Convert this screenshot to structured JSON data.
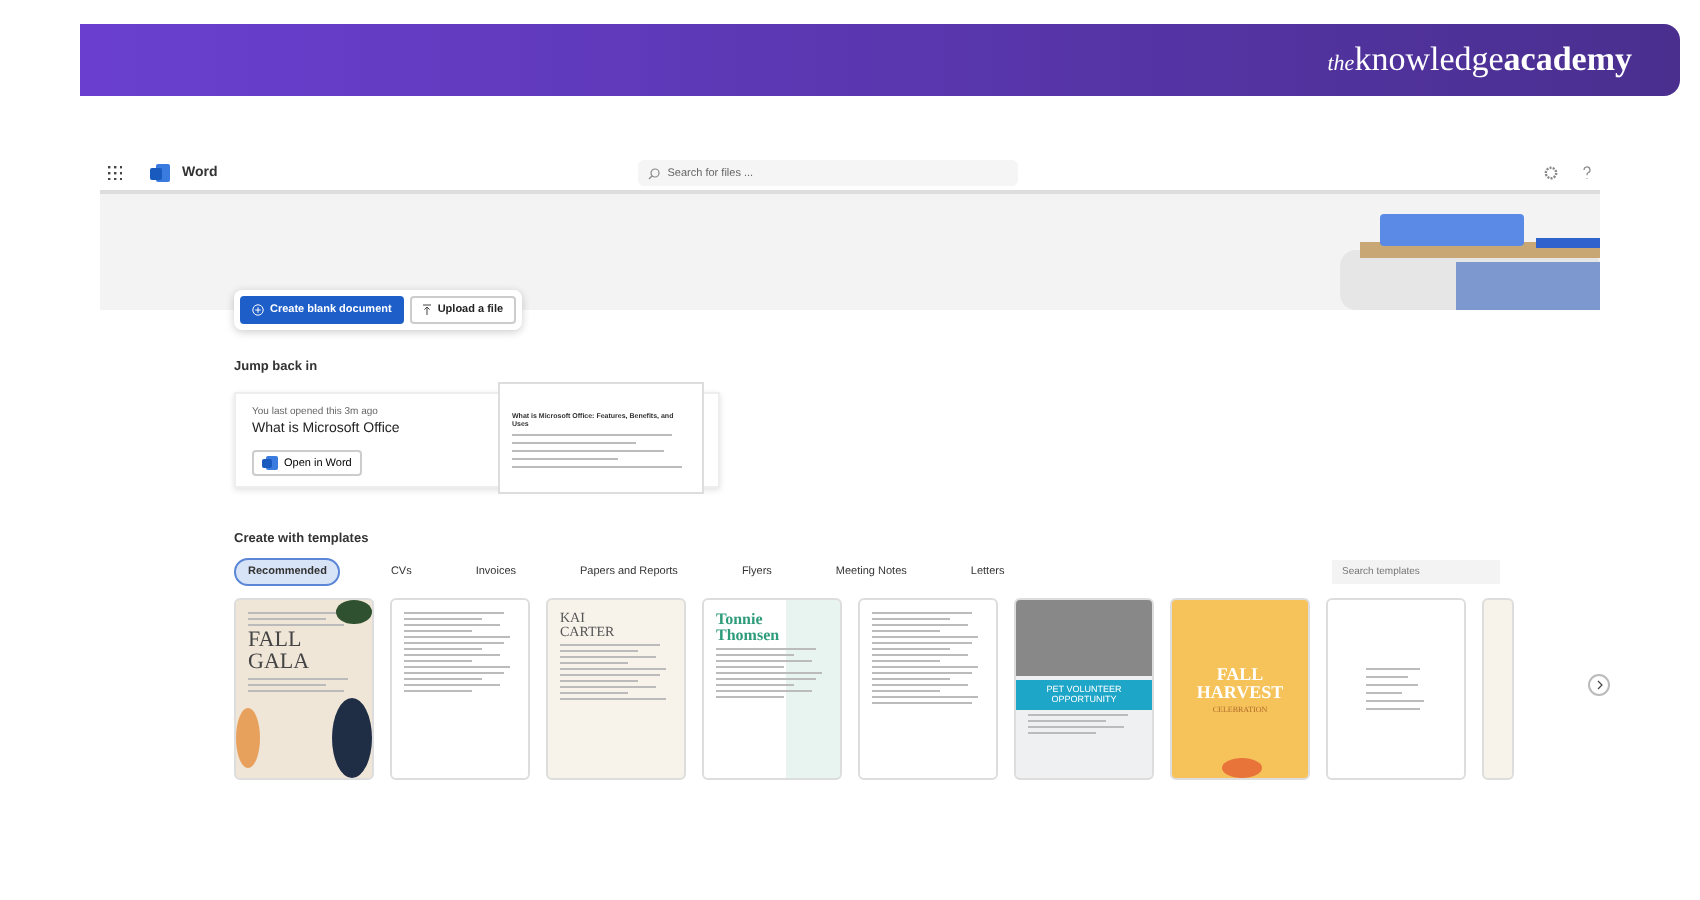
{
  "banner": {
    "brand_prefix": "the",
    "brand_main": "knowledge",
    "brand_suffix": "academy"
  },
  "topbar": {
    "app_name": "Word",
    "search": {
      "placeholder": "Search for files ..."
    }
  },
  "actions": [
    {
      "label": "Create blank document",
      "kind": "primary"
    },
    {
      "label": "Upload a file",
      "kind": "secondary"
    }
  ],
  "jump_back": {
    "heading": "Jump back in",
    "recent": {
      "opened": "You last opened this 3m ago",
      "title": "What is Microsoft Office",
      "button": "Open in Word",
      "preview_title": "What is Microsoft Office: Features, Benefits, and Uses"
    }
  },
  "templates": {
    "heading": "Create with templates",
    "tabs": [
      {
        "label": "Recommended",
        "selected": true
      },
      {
        "label": "CVs",
        "selected": false
      },
      {
        "label": "Invoices",
        "selected": false
      },
      {
        "label": "Papers and Reports",
        "selected": false
      },
      {
        "label": "Flyers",
        "selected": false
      },
      {
        "label": "Meeting Notes",
        "selected": false
      },
      {
        "label": "Letters",
        "selected": false
      }
    ],
    "search": {
      "placeholder": "Search templates"
    },
    "items": [
      {
        "kind": "gala",
        "title": "FALL GALA"
      },
      {
        "kind": "letter"
      },
      {
        "kind": "resume",
        "title": "KAI CARTER"
      },
      {
        "kind": "resume-green",
        "title": "Tonnie Thomsen"
      },
      {
        "kind": "invoice"
      },
      {
        "kind": "pet",
        "title": "PET VOLUNTEER OPPORTUNITY"
      },
      {
        "kind": "harvest",
        "title": "FALL HARVEST",
        "subtitle": "CELEBRATION"
      },
      {
        "kind": "list"
      },
      {
        "kind": "partial"
      }
    ]
  }
}
